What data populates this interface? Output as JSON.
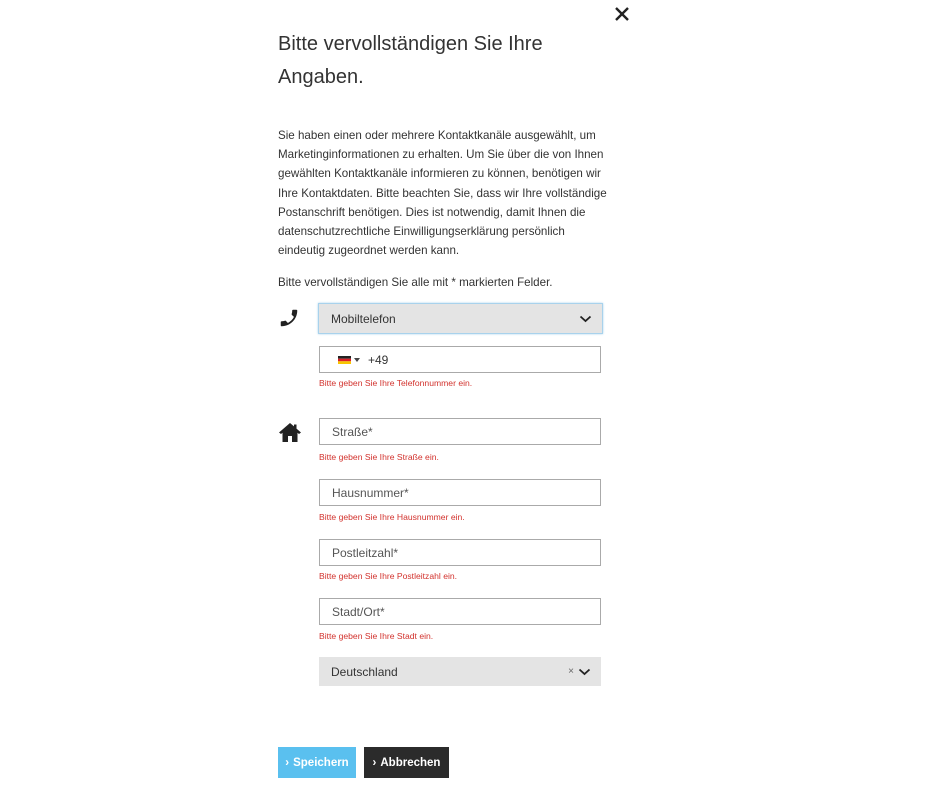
{
  "dialog": {
    "title": "Bitte vervollständigen Sie Ihre Angaben.",
    "intro": "Sie haben einen oder mehrere Kontaktkanäle ausgewählt, um Marketinginformationen zu erhalten. Um Sie über die von Ihnen gewählten Kontaktkanäle informieren zu können, benötigen wir Ihre Kontaktdaten. Bitte beachten Sie, dass wir Ihre vollständige Postanschrift benötigen. Dies ist notwendig, damit Ihnen die datenschutzrechtliche Einwilligungserklärung persönlich eindeutig zugeordnet werden kann.",
    "required_note": "Bitte vervollständigen Sie alle mit * markierten Felder."
  },
  "phone": {
    "icon": "phone-icon",
    "type_selected": "Mobiltelefon",
    "country_flag": "flag-de-icon",
    "dial_code": "+49",
    "error": "Bitte geben Sie Ihre Telefonnummer ein."
  },
  "address": {
    "icon": "home-icon",
    "street": {
      "placeholder": "Straße*",
      "error": "Bitte geben Sie Ihre Straße ein."
    },
    "house_number": {
      "placeholder": "Hausnummer*",
      "error": "Bitte geben Sie Ihre Hausnummer ein."
    },
    "postal_code": {
      "placeholder": "Postleitzahl*",
      "error": "Bitte geben Sie Ihre Postleitzahl ein."
    },
    "city": {
      "placeholder": "Stadt/Ort*",
      "error": "Bitte geben Sie Ihre Stadt ein."
    },
    "country_selected": "Deutschland",
    "country_clear": "×"
  },
  "actions": {
    "save_label": "Speichern",
    "cancel_label": "Abbrechen",
    "arrow": "›"
  },
  "colors": {
    "save_button": "#5ac0ef",
    "cancel_button": "#2b2b2b",
    "error_text": "#d2322d",
    "select_background": "#e4e4e4",
    "focus_border": "#a8d2ec"
  }
}
